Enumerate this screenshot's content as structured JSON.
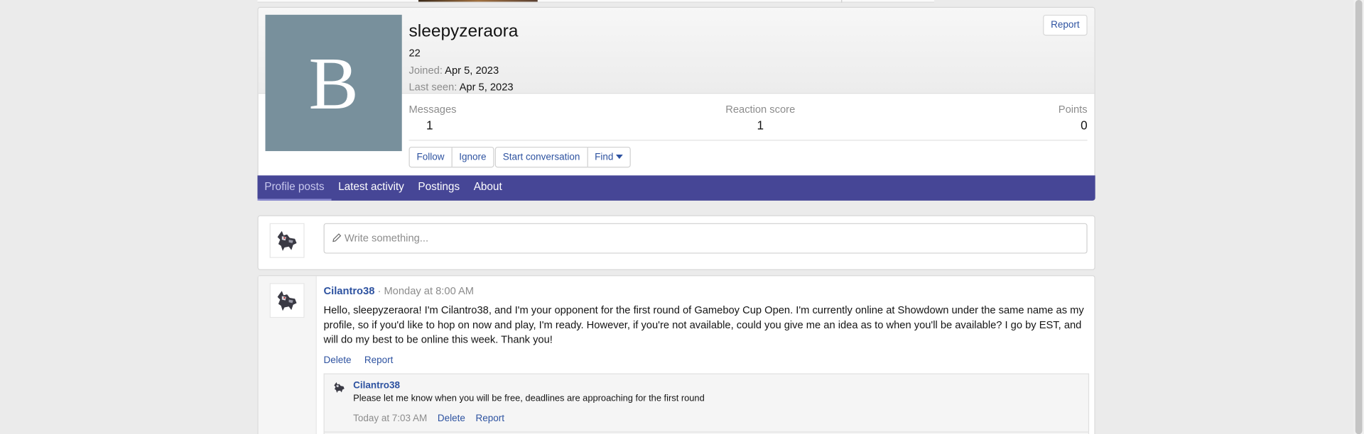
{
  "profile": {
    "avatar_letter": "B",
    "username": "sleepyzeraora",
    "user_title": "22",
    "joined_label": "Joined:",
    "joined_value": "Apr 5, 2023",
    "last_seen_label": "Last seen:",
    "last_seen_value": "Apr 5, 2023",
    "report_label": "Report",
    "stats": {
      "messages_label": "Messages",
      "messages_value": "1",
      "reaction_label": "Reaction score",
      "reaction_value": "1",
      "points_label": "Points",
      "points_value": "0"
    },
    "actions": {
      "follow": "Follow",
      "ignore": "Ignore",
      "start_conversation": "Start conversation",
      "find": "Find"
    },
    "avatar_color": "#78909c"
  },
  "tabs": [
    {
      "label": "Profile posts",
      "active": true
    },
    {
      "label": "Latest activity"
    },
    {
      "label": "Postings"
    },
    {
      "label": "About"
    }
  ],
  "composer": {
    "placeholder": "Write something..."
  },
  "post": {
    "author": "Cilantro38",
    "separator": " · ",
    "time": "Monday at 8:00 AM",
    "body": "Hello, sleepyzeraora! I'm Cilantro38, and I'm your opponent for the first round of Gameboy Cup Open. I'm currently online at Showdown under the same name as my profile, so if you'd like to hop on now and play, I'm ready. However, if you're not available, could you give me an idea as to when you'll be available? I go by EST, and will do my best to be online this week. Thank you!",
    "delete_label": "Delete",
    "report_label": "Report",
    "comment": {
      "author": "Cilantro38",
      "text": "Please let me know when you will be free, deadlines are approaching for the first round",
      "time": "Today at 7:03 AM",
      "delete_label": "Delete",
      "report_label": "Report"
    }
  },
  "colors": {
    "nav_bg": "#464696",
    "link": "#2d52a0"
  }
}
